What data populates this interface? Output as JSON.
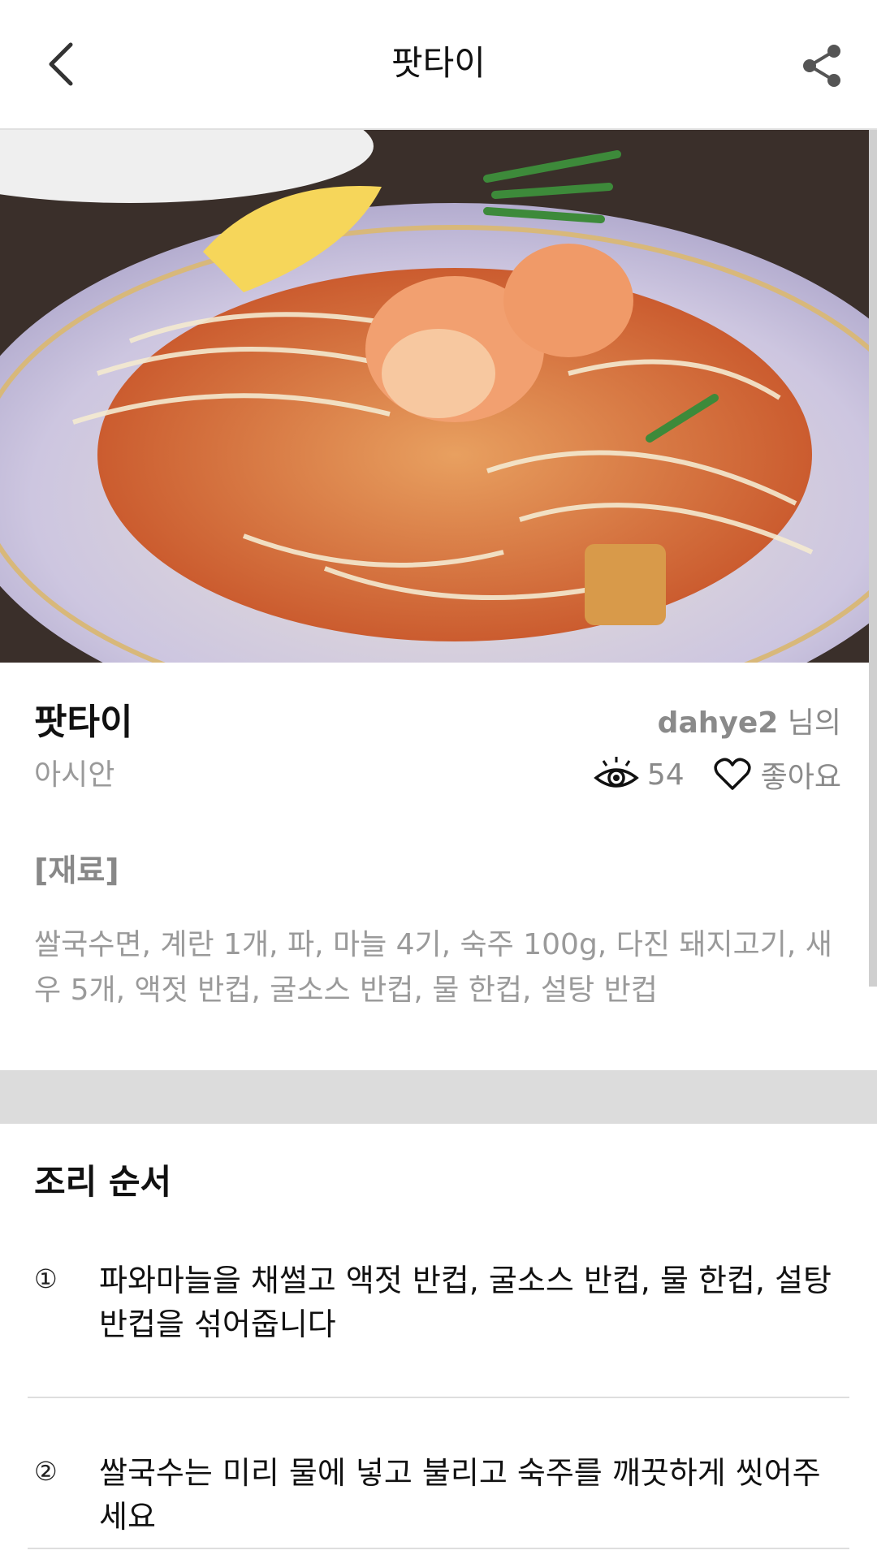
{
  "header": {
    "title": "팟타이"
  },
  "recipe": {
    "title": "팟타이",
    "author_name": "dahye2",
    "author_suffix": "님의",
    "category": "아시안",
    "views": "54",
    "like_label": "좋아요"
  },
  "ingredients": {
    "heading": "[재료]",
    "text": "쌀국수면, 계란 1개, 파, 마늘 4기, 숙주 100g, 다진 돼지고기, 새우 5개, 액젓 반컵, 굴소스 반컵, 물 한컵, 설탕 반컵"
  },
  "steps": {
    "heading": "조리 순서",
    "items": [
      {
        "num": "①",
        "text": "파와마늘을 채썰고 액젓 반컵, 굴소스 반컵, 물 한컵, 설탕 반컵을 섞어줍니다"
      },
      {
        "num": "②",
        "text": "쌀국수는 미리 물에 넣고 불리고 숙주를 깨끗하게 씻어주세요"
      }
    ]
  },
  "icons": {
    "back": "chevron-left-icon",
    "share": "share-icon",
    "views": "eye-icon",
    "like": "heart-icon"
  }
}
